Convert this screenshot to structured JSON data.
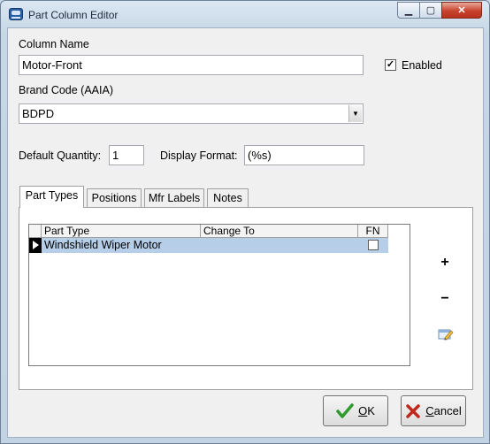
{
  "window": {
    "title": "Part Column Editor"
  },
  "title_buttons": {
    "minimize": "▁",
    "maximize": "▢",
    "close": "✕"
  },
  "form": {
    "column_name_label": "Column Name",
    "column_name_value": "Motor-Front",
    "enabled_label": "Enabled",
    "enabled_checked": true,
    "brand_code_label": "Brand Code (AAIA)",
    "brand_code_value": "BDPD",
    "default_quantity_label": "Default Quantity:",
    "default_quantity_value": "1",
    "display_format_label": "Display Format:",
    "display_format_value": "(%s)"
  },
  "tabs": [
    {
      "label": "Part Types",
      "active": true
    },
    {
      "label": "Positions",
      "active": false
    },
    {
      "label": "Mfr Labels",
      "active": false
    },
    {
      "label": "Notes",
      "active": false
    }
  ],
  "grid": {
    "columns": [
      "Part Type",
      "Change To",
      "FN"
    ],
    "rows": [
      {
        "part_type": "Windshield Wiper Motor",
        "change_to": "",
        "fn_checked": false
      }
    ]
  },
  "side_buttons": {
    "add": "+",
    "remove": "−",
    "edit": "pencil-icon"
  },
  "buttons": {
    "ok_prefix": "",
    "ok_mnemonic": "O",
    "ok_rest": "K",
    "cancel_mnemonic": "C",
    "cancel_rest": "ancel"
  },
  "colors": {
    "selection": "#b6cee8",
    "ok_check": "#2e9a2e",
    "cancel_x": "#c0281c"
  }
}
